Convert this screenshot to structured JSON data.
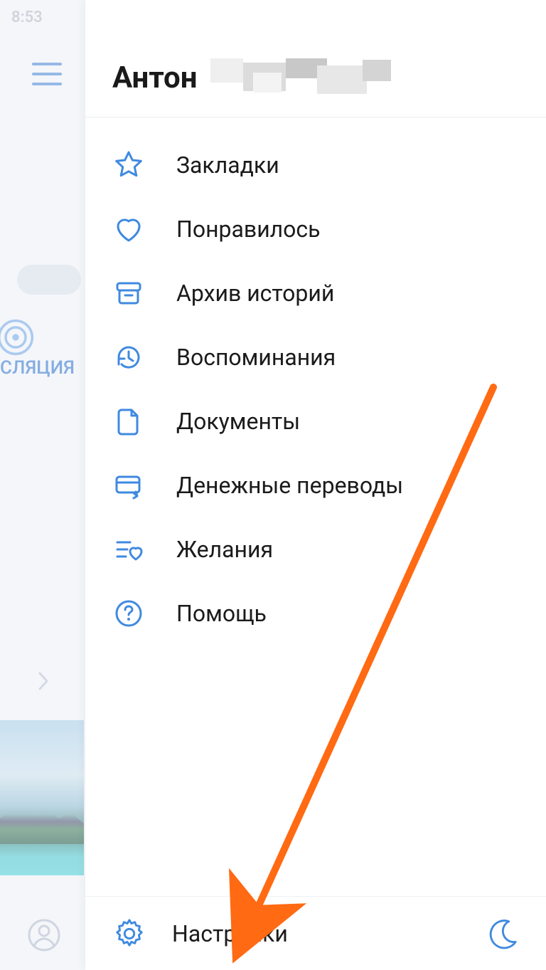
{
  "status": {
    "time": "8:53"
  },
  "background": {
    "broadcast_partial_label": "СЛЯЦИЯ"
  },
  "header": {
    "user_name": "Антон"
  },
  "menu": [
    {
      "key": "bookmarks",
      "label": "Закладки",
      "icon": "star-icon"
    },
    {
      "key": "liked",
      "label": "Понравилось",
      "icon": "heart-icon"
    },
    {
      "key": "stories-archive",
      "label": "Архив историй",
      "icon": "archive-icon"
    },
    {
      "key": "memories",
      "label": "Воспоминания",
      "icon": "history-icon"
    },
    {
      "key": "documents",
      "label": "Документы",
      "icon": "document-icon"
    },
    {
      "key": "money-transfers",
      "label": "Денежные переводы",
      "icon": "card-icon"
    },
    {
      "key": "wishes",
      "label": "Желания",
      "icon": "wishlist-icon"
    },
    {
      "key": "help",
      "label": "Помощь",
      "icon": "help-icon"
    }
  ],
  "footer": {
    "settings_label": "Настройки"
  },
  "colors": {
    "icon": "#3f8ae0",
    "text": "#1b1b1b",
    "arrow": "#ff6a13"
  }
}
